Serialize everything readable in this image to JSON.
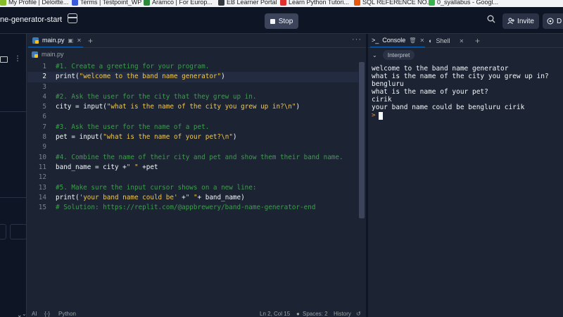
{
  "bookmarks": [
    {
      "label": "My Profile | Deloitte...",
      "color": "#86bc25"
    },
    {
      "label": "Terms | Testpoint_WP",
      "color": "#3b5bdb"
    },
    {
      "label": "Aramco | For Europ...",
      "color": "#2b8a3e"
    },
    {
      "label": "EB Learner Portal",
      "color": "#343a40"
    },
    {
      "label": "Learn Python Tutori...",
      "color": "#e03131"
    },
    {
      "label": "SQL REFERENCE NO...",
      "color": "#e8590c"
    },
    {
      "label": "0_syallabus - Googl...",
      "color": "#37b24d"
    }
  ],
  "topbar": {
    "repl_name": "ne-generator-start",
    "stop_label": "Stop",
    "invite_label": "Invite",
    "deploy_label": "D"
  },
  "editor": {
    "tab_label": "main.py",
    "breadcrumb": "main.py",
    "active_line": 2,
    "lines": [
      {
        "n": "1",
        "tokens": [
          {
            "t": "#1. Create a greeting for your program.",
            "c": "comment"
          }
        ]
      },
      {
        "n": "2",
        "tokens": [
          {
            "t": "print",
            "c": "fn"
          },
          {
            "t": "(",
            "c": "plain"
          },
          {
            "t": "\"welcome to the band name generator\"",
            "c": "str"
          },
          {
            "t": ")",
            "c": "plain"
          }
        ]
      },
      {
        "n": "3",
        "tokens": []
      },
      {
        "n": "4",
        "tokens": [
          {
            "t": "#2. Ask the user for the city that they grew up in.",
            "c": "comment"
          }
        ]
      },
      {
        "n": "5",
        "tokens": [
          {
            "t": "city = ",
            "c": "plain"
          },
          {
            "t": "input",
            "c": "fn"
          },
          {
            "t": "(",
            "c": "plain"
          },
          {
            "t": "\"what is the name of the city you grew up in?\\n\"",
            "c": "str"
          },
          {
            "t": ")",
            "c": "plain"
          }
        ]
      },
      {
        "n": "6",
        "tokens": []
      },
      {
        "n": "7",
        "tokens": [
          {
            "t": "#3. Ask the user for the name of a pet.",
            "c": "comment"
          }
        ]
      },
      {
        "n": "8",
        "tokens": [
          {
            "t": "pet = ",
            "c": "plain"
          },
          {
            "t": "input",
            "c": "fn"
          },
          {
            "t": "(",
            "c": "plain"
          },
          {
            "t": "\"what is the name of your pet?\\n\"",
            "c": "str"
          },
          {
            "t": ")",
            "c": "plain"
          }
        ]
      },
      {
        "n": "9",
        "tokens": []
      },
      {
        "n": "10",
        "tokens": [
          {
            "t": "#4. Combine the name of their city and pet and show them their band name.",
            "c": "comment"
          }
        ]
      },
      {
        "n": "11",
        "tokens": [
          {
            "t": "band_name = city +",
            "c": "plain"
          },
          {
            "t": "\" \"",
            "c": "str"
          },
          {
            "t": " +pet",
            "c": "plain"
          }
        ]
      },
      {
        "n": "12",
        "tokens": []
      },
      {
        "n": "13",
        "tokens": [
          {
            "t": "#5. Make sure the input cursor shows on a new line:",
            "c": "comment"
          }
        ]
      },
      {
        "n": "14",
        "tokens": [
          {
            "t": "print",
            "c": "fn"
          },
          {
            "t": "(",
            "c": "plain"
          },
          {
            "t": "'your band name could be'",
            "c": "str"
          },
          {
            "t": " +",
            "c": "plain"
          },
          {
            "t": "\" \"",
            "c": "str"
          },
          {
            "t": "+ band_name)",
            "c": "plain"
          }
        ]
      },
      {
        "n": "15",
        "tokens": [
          {
            "t": "# Solution: https://replit.com/@appbrewery/band-name-generator-end",
            "c": "comment"
          }
        ]
      }
    ]
  },
  "statusbar": {
    "ai_label": "AI",
    "language": "Python",
    "position": "Ln 2, Col 15",
    "spaces": "Spaces: 2",
    "history": "History"
  },
  "console": {
    "tab_console": "Console",
    "tab_shell": "Shell",
    "interpret_label": "Interpret",
    "output": [
      "welcome to the band name generator",
      "what is the name of the city you grew up in?",
      "bengluru",
      "what is the name of your pet?",
      "cirik",
      "your band name could be bengluru cirik"
    ],
    "prompt_symbol": ">"
  }
}
